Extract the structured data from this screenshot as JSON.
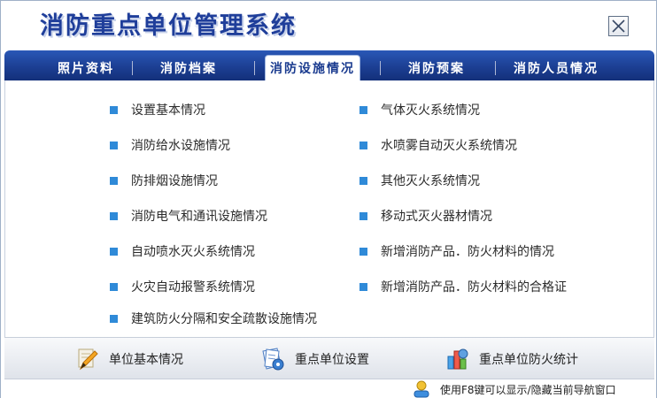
{
  "app": {
    "title": "消防重点单位管理系统"
  },
  "tabs": [
    {
      "label": "照片资料"
    },
    {
      "label": "消防档案"
    },
    {
      "label": "消防设施情况",
      "active": true
    },
    {
      "label": "消防预案"
    },
    {
      "label": "消防人员情况"
    }
  ],
  "facilities": {
    "left": [
      "设置基本情况",
      "消防给水设施情况",
      "防排烟设施情况",
      "消防电气和通讯设施情况",
      "自动喷水灭火系统情况",
      "火灾自动报警系统情况",
      "建筑防火分隔和安全疏散设施情况"
    ],
    "right": [
      "气体灭火系统情况",
      "水喷雾自动灭火系统情况",
      "其他灭火系统情况",
      "移动式灭火器材情况",
      "新增消防产品．防火材料的情况",
      "新增消防产品．防火材料的合格证"
    ]
  },
  "bottom": {
    "unit_info": "单位基本情况",
    "key_unit_settings": "重点单位设置",
    "key_unit_stats": "重点单位防火统计"
  },
  "status": {
    "hint": "使用F8键可以显示/隐藏当前导航窗口"
  },
  "colors": {
    "tabbar": "#1c3f93",
    "bullet": "#2f8ad8",
    "title": "#1f3e9a"
  }
}
